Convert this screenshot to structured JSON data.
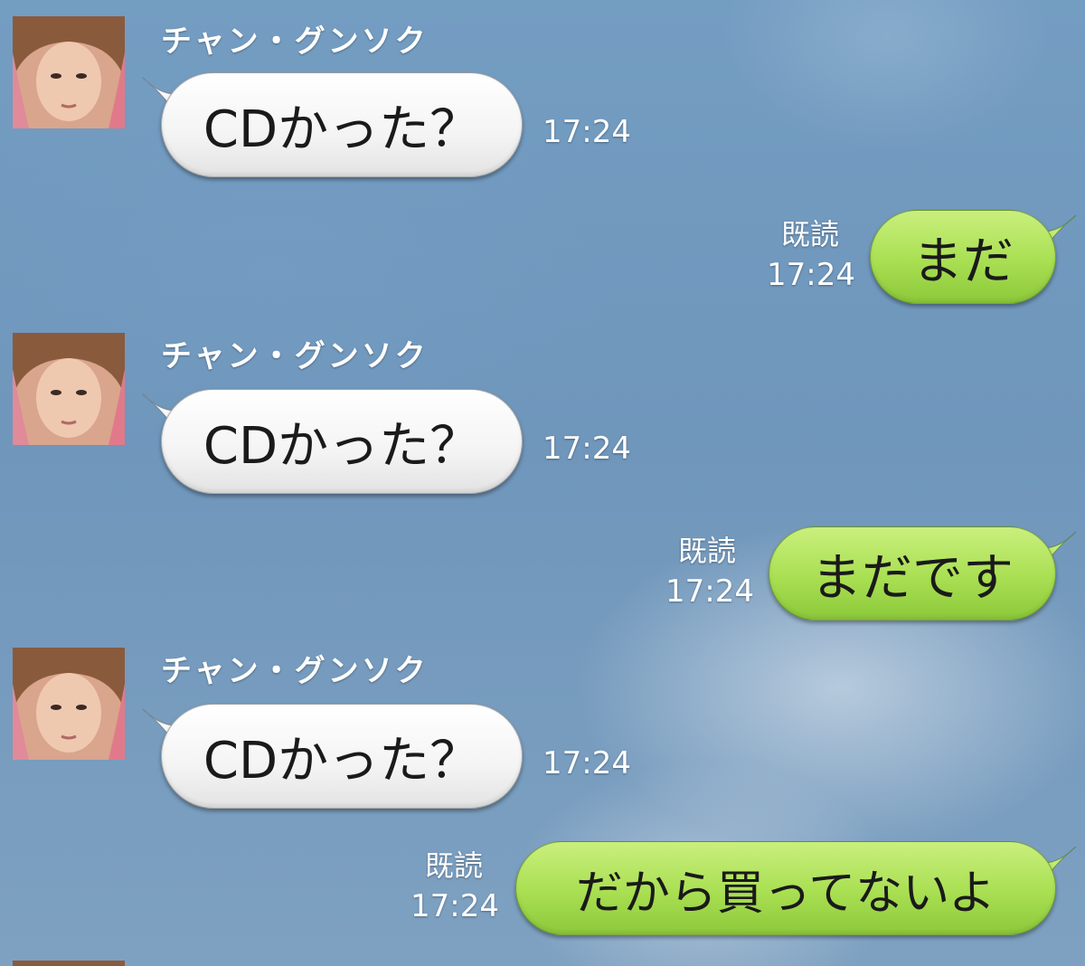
{
  "chat": {
    "messages": [
      {
        "direction": "in",
        "sender": "チャン・グンソク",
        "text": "CDかった？",
        "time": "17:24"
      },
      {
        "direction": "out",
        "read": "既読",
        "text": "まだ",
        "time": "17:24"
      },
      {
        "direction": "in",
        "sender": "チャン・グンソク",
        "text": "CDかった？",
        "time": "17:24"
      },
      {
        "direction": "out",
        "read": "既読",
        "text": "まだです",
        "time": "17:24"
      },
      {
        "direction": "in",
        "sender": "チャン・グンソク",
        "text": "CDかった？",
        "time": "17:24"
      },
      {
        "direction": "out",
        "read": "既読",
        "text": "だから買ってないよ",
        "time": "17:24"
      }
    ]
  },
  "colors": {
    "incoming_bubble": "#f4f4f4",
    "outgoing_bubble": "#a9df52",
    "background": "#6f96bb"
  }
}
